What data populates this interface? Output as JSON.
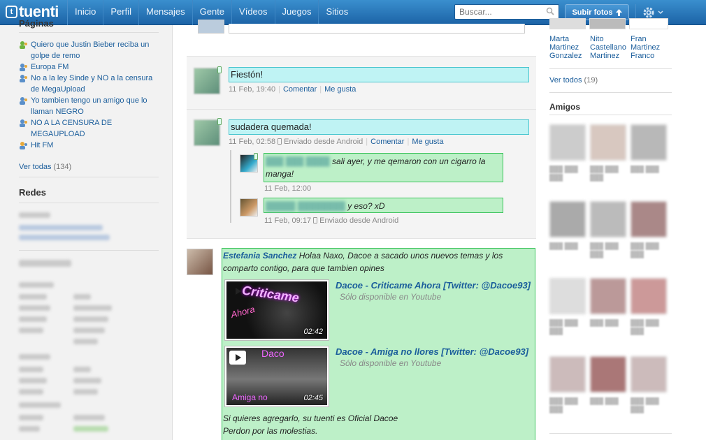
{
  "header": {
    "logo": "tuenti",
    "nav": [
      "Inicio",
      "Perfil",
      "Mensajes",
      "Gente",
      "Vídeos",
      "Juegos",
      "Sitios"
    ],
    "search_placeholder": "Buscar...",
    "upload_label": "Subir fotos",
    "colors": {
      "bar_top": "#3a8fce",
      "bar_bottom": "#1c63a6"
    }
  },
  "left": {
    "pages_title": "Páginas",
    "pages": [
      "Quiero que Justin Bieber reciba un golpe de remo",
      "Europa FM",
      "No a la ley Sinde y NO a la censura de MegaUpload",
      "Yo tambien tengo un amigo que lo llaman NEGRO",
      "NO A LA CENSURA DE MEGAUPLOAD",
      "Hit FM"
    ],
    "see_all_label": "Ver todas",
    "see_all_count": "(134)",
    "networks_title": "Redes"
  },
  "feed": {
    "posts": [
      {
        "text": "Fiestón!",
        "date": "11 Feb, 19:40",
        "comment": "Comentar",
        "like": "Me gusta"
      },
      {
        "text": "sudadera quemada!",
        "date": "11 Feb, 02:58",
        "via": "Enviado desde Android",
        "comment": "Comentar",
        "like": "Me gusta"
      }
    ],
    "comments": [
      {
        "text": "sali ayer, y me qemaron con un cigarro la manga!",
        "date": "11 Feb, 12:00"
      },
      {
        "text": "y eso? xD",
        "date": "11 Feb, 09:17",
        "via": "Enviado desde Android"
      }
    ],
    "share": {
      "author": "Estefania Sanchez",
      "intro": "Holaa Naxo, Dacoe a sacado unos nuevos temas y los comparto contigo, para que tambien opines",
      "videos": [
        {
          "title": "Dacoe - Criticame Ahora [Twitter: @Dacoe93]",
          "sub": "Sólo disponible en Youtube",
          "duration": "02:42"
        },
        {
          "title": "Dacoe - Amiga no llores [Twitter: @Dacoe93]",
          "sub": "Sólo disponible en Youtube",
          "duration": "02:45"
        }
      ],
      "outro1": "Si quieres agregarlo, su tuenti es Oficial Dacoe",
      "outro2": "Perdon por las molestias."
    }
  },
  "right": {
    "top_friends": [
      {
        "l1": "Marta",
        "l2": "Martinez",
        "l3": "Gonzalez"
      },
      {
        "l1": "Nito",
        "l2": "Castellano",
        "l3": "Martinez"
      },
      {
        "l1": "Fran",
        "l2": "Martinez",
        "l3": "Franco"
      }
    ],
    "see_all_label": "Ver todos",
    "see_all_count": "(19)",
    "friends_title": "Amigos"
  }
}
